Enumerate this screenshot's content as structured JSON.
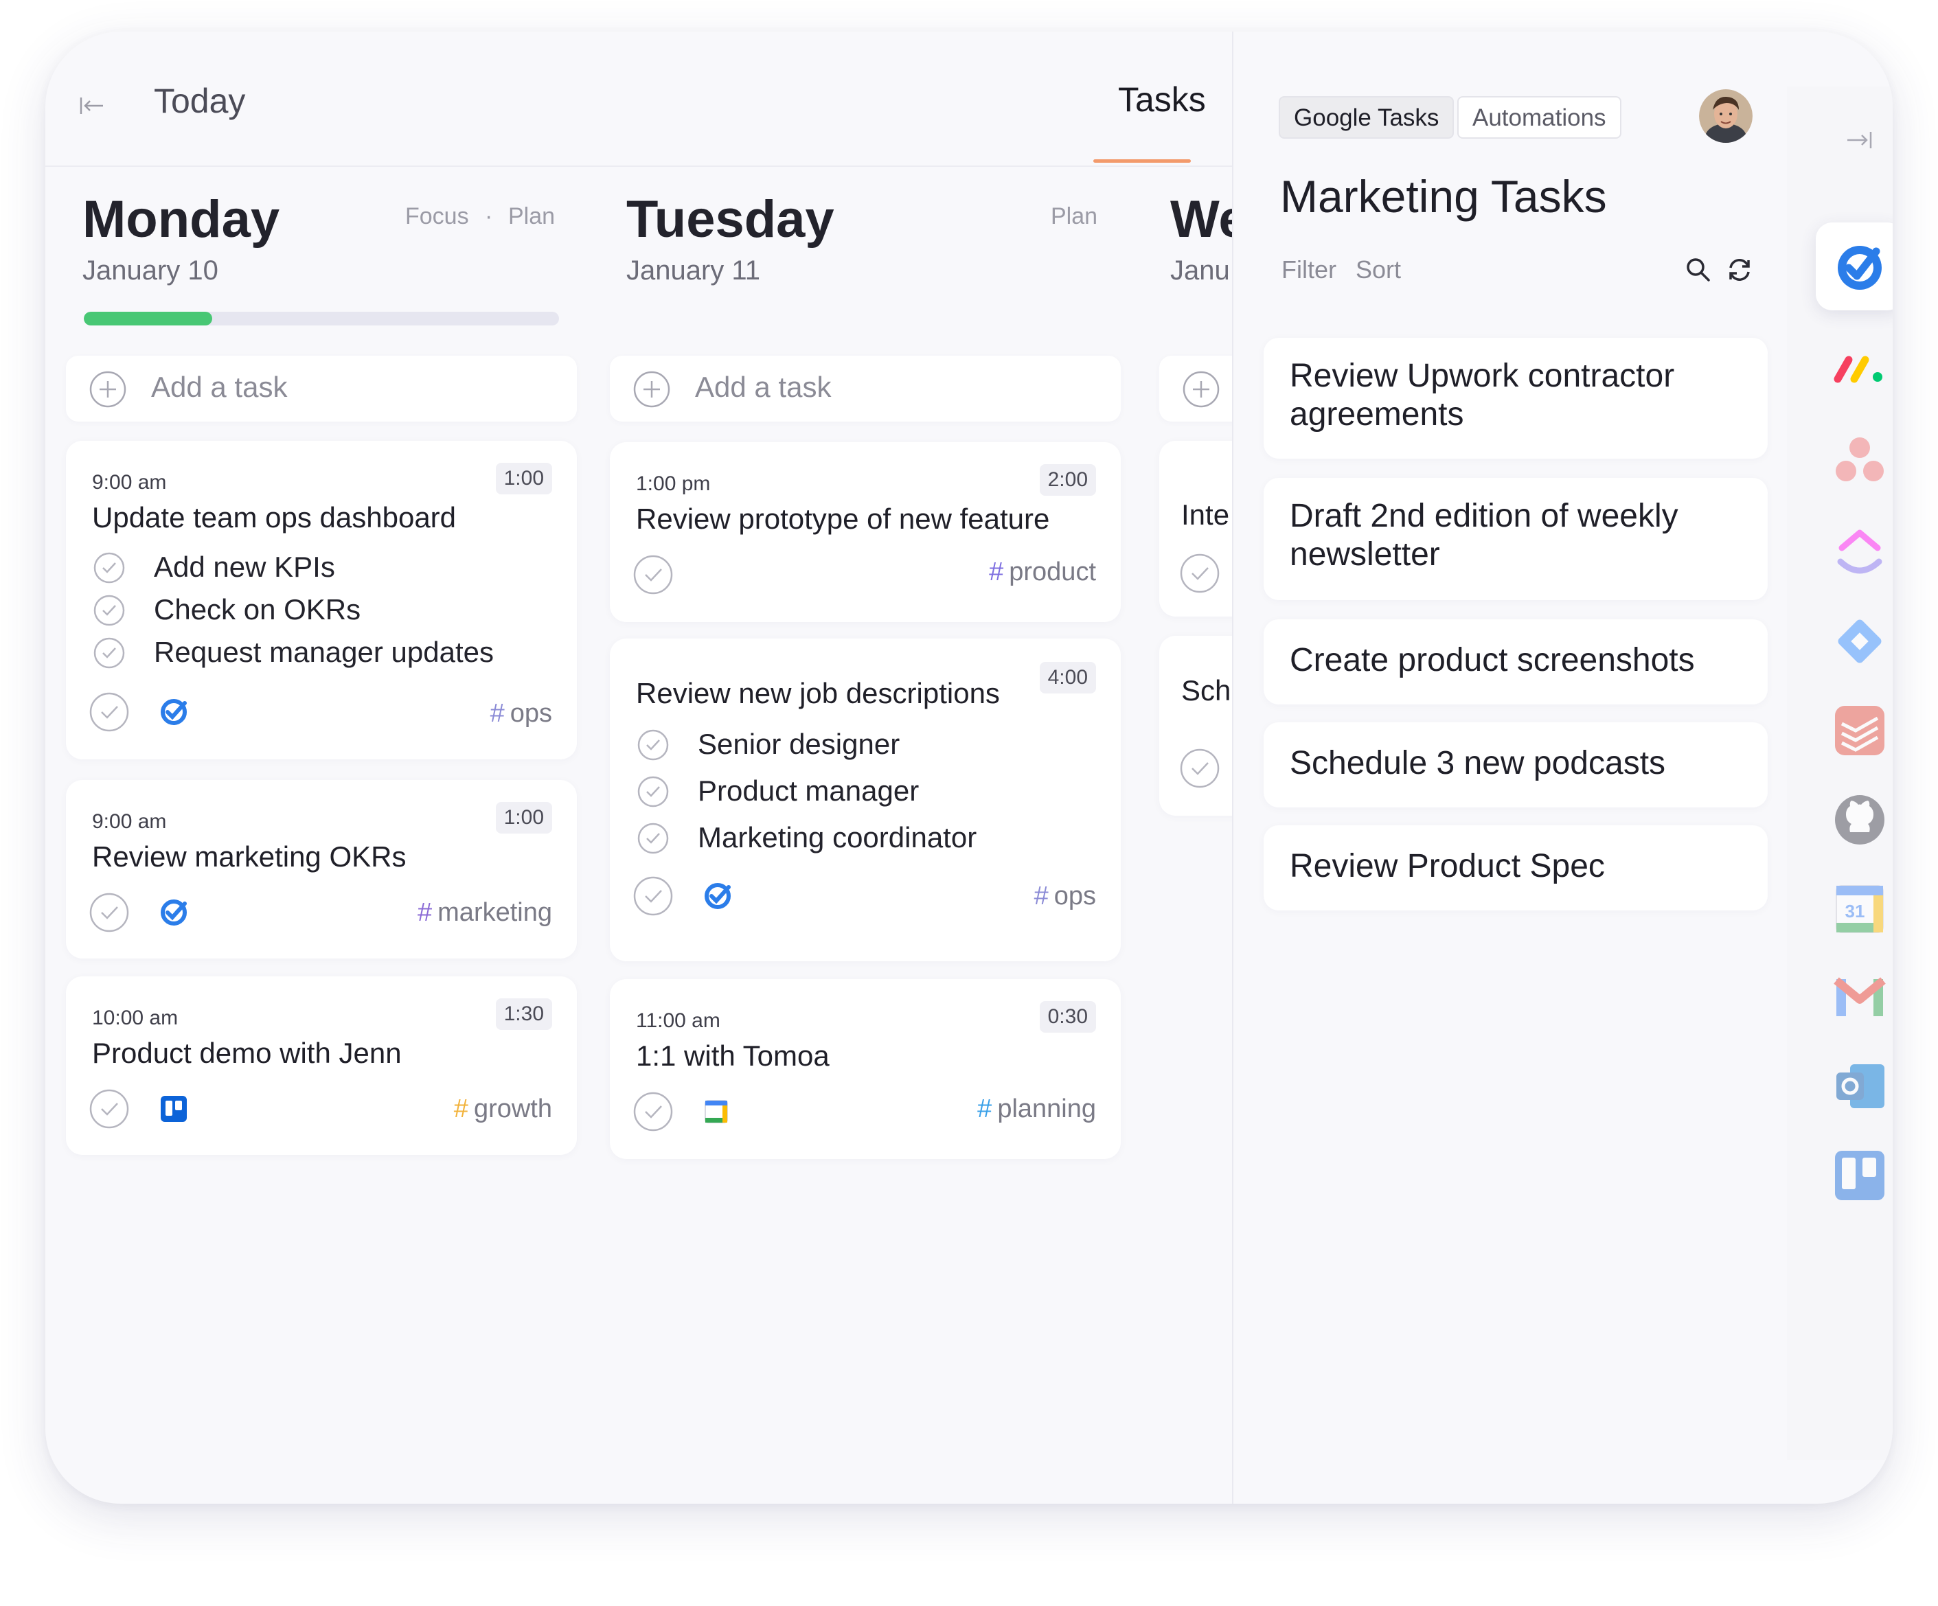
{
  "header": {
    "title": "Today",
    "tab": "Tasks"
  },
  "days": [
    {
      "name": "Monday",
      "date": "January 10",
      "links": [
        "Focus",
        "·",
        "Plan"
      ],
      "progress": 0.27,
      "add_task": "Add a task",
      "cards": [
        {
          "time": "9:00 am",
          "title": "Update team ops dashboard",
          "duration": "1:00",
          "subtasks": [
            "Add new KPIs",
            "Check on OKRs",
            "Request manager updates"
          ],
          "source_icon": "google-tasks-icon",
          "tag": "ops",
          "tag_color": "#8b8bd6"
        },
        {
          "time": "9:00 am",
          "title": "Review marketing OKRs",
          "duration": "1:00",
          "source_icon": "google-tasks-icon",
          "tag": "marketing",
          "tag_color": "#8b6bd6"
        },
        {
          "time": "10:00 am",
          "title": "Product demo with Jenn",
          "duration": "1:30",
          "source_icon": "trello-icon",
          "tag": "growth",
          "tag_color": "#f2b23a"
        }
      ]
    },
    {
      "name": "Tuesday",
      "date": "January 11",
      "links": [
        "Plan"
      ],
      "add_task": "Add a task",
      "cards": [
        {
          "time": "1:00 pm",
          "title": "Review prototype of new feature",
          "duration": "2:00",
          "tag": "product",
          "tag_color": "#7d6ee0"
        },
        {
          "title": "Review new job descriptions",
          "duration": "4:00",
          "subtasks": [
            "Senior designer",
            "Product manager",
            "Marketing coordinator"
          ],
          "source_icon": "google-tasks-icon",
          "tag": "ops",
          "tag_color": "#8b8bd6"
        },
        {
          "time": "11:00 am",
          "title": "1:1 with Tomoa",
          "duration": "0:30",
          "source_icon": "google-calendar-icon",
          "tag": "planning",
          "tag_color": "#3aa0e8"
        }
      ]
    },
    {
      "name": "We",
      "date": "Janu",
      "cards": [
        {
          "title": "Inte"
        },
        {
          "title": "Sche"
        }
      ]
    }
  ],
  "panel": {
    "chips": [
      "Google Tasks",
      "Automations"
    ],
    "title": "Marketing Tasks",
    "options": [
      "Filter",
      "Sort"
    ],
    "tasks": [
      "Review Upwork contractor agreements",
      "Draft 2nd edition of weekly newsletter",
      "Create product screenshots",
      "Schedule 3 new podcasts",
      "Review Product Spec"
    ]
  },
  "rail": {
    "icons": [
      "collapse-panel-icon",
      "google-tasks-icon",
      "monday-icon",
      "asana-icon",
      "clickup-icon",
      "jira-icon",
      "todoist-icon",
      "github-icon",
      "google-calendar-icon",
      "gmail-icon",
      "outlook-icon",
      "trello-icon"
    ],
    "active": "google-tasks-icon",
    "calendar_day": "31"
  }
}
